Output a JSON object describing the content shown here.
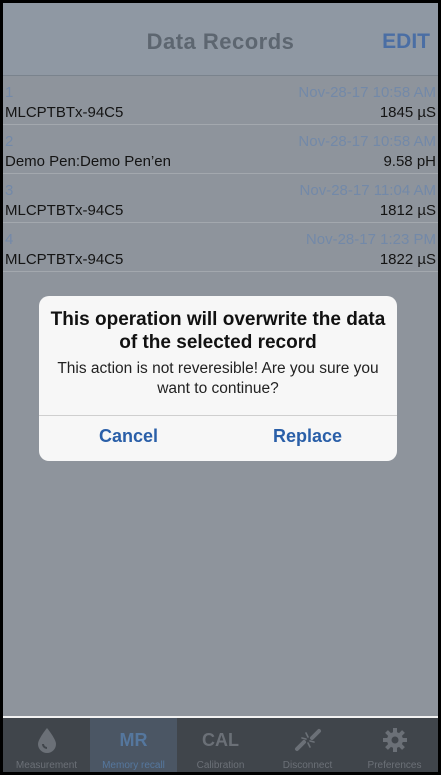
{
  "navbar": {
    "title": "Data Records",
    "edit_label": "EDIT"
  },
  "records": [
    {
      "num": "1",
      "date": "Nov-28-17 10:58 AM",
      "name": "MLCPTBTx-94C5",
      "value": "1845 µS"
    },
    {
      "num": "2",
      "date": "Nov-28-17 10:58 AM",
      "name": "Demo Pen:Demo Pen’en",
      "value": "9.58 pH"
    },
    {
      "num": "3",
      "date": "Nov-28-17 11:04 AM",
      "name": "MLCPTBTx-94C5",
      "value": "1812 µS"
    },
    {
      "num": "4",
      "date": "Nov-28-17 1:23 PM",
      "name": "MLCPTBTx-94C5",
      "value": "1822 µS"
    }
  ],
  "dialog": {
    "title": "This operation will overwrite the data of the selected record",
    "message": "This action is not reveresible! Are you sure you want to continue?",
    "cancel_label": "Cancel",
    "replace_label": "Replace"
  },
  "tabbar": {
    "tabs": [
      {
        "label": "Measurement",
        "icon": "drop-icon",
        "text_icon": ""
      },
      {
        "label": "Memory recall",
        "icon": "mr-icon",
        "text_icon": "MR"
      },
      {
        "label": "Calibration",
        "icon": "cal-icon",
        "text_icon": "CAL"
      },
      {
        "label": "Disconnect",
        "icon": "disconnect-icon",
        "text_icon": ""
      },
      {
        "label": "Preferences",
        "icon": "gear-icon",
        "text_icon": ""
      }
    ]
  },
  "colors": {
    "accent": "#2a5fa8",
    "navbar": "#8f98a3",
    "dim_overlay": "#8e949c",
    "tabbar": "#40454b"
  }
}
